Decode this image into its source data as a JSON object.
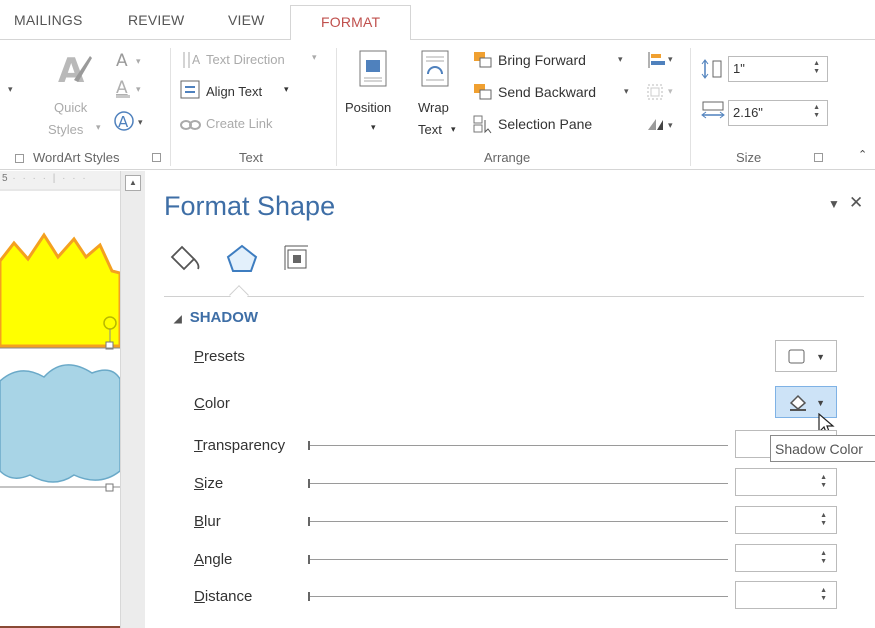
{
  "tabs": {
    "mailings": "MAILINGS",
    "review": "REVIEW",
    "view": "VIEW",
    "format": "FORMAT"
  },
  "ribbon": {
    "wordart": {
      "quick_styles_line1": "Quick",
      "quick_styles_line2": "Styles",
      "group_label": "WordArt Styles"
    },
    "text": {
      "text_direction": "Text Direction",
      "align_text": "Align Text",
      "create_link": "Create Link",
      "group_label": "Text"
    },
    "arrange": {
      "position": "Position",
      "wrap_line1": "Wrap",
      "wrap_line2": "Text",
      "bring_forward": "Bring Forward",
      "send_backward": "Send Backward",
      "selection_pane": "Selection Pane",
      "group_label": "Arrange"
    },
    "size": {
      "height_value": "1\"",
      "width_value": "2.16\"",
      "group_label": "Size"
    }
  },
  "ruler": {
    "mark": "5"
  },
  "pane": {
    "title": "Format Shape",
    "section": "SHADOW",
    "rows": {
      "presets": {
        "first": "P",
        "rest": "resets"
      },
      "color": {
        "first": "C",
        "rest": "olor"
      },
      "transparency": {
        "first": "T",
        "rest": "ransparency"
      },
      "size": {
        "first": "S",
        "rest": "ize"
      },
      "blur": {
        "first": "B",
        "rest": "lur"
      },
      "angle": {
        "first": "A",
        "rest": "ngle"
      },
      "distance": {
        "first": "D",
        "rest": "istance"
      }
    },
    "tooltip": "Shadow Color"
  },
  "icons": [
    "quick-styles-icon",
    "text-fill-icon",
    "text-outline-icon",
    "text-effects-icon",
    "text-direction-icon",
    "align-text-icon",
    "create-link-icon",
    "position-icon",
    "wrap-text-icon",
    "bring-forward-icon",
    "send-backward-icon",
    "selection-pane-icon",
    "align-icon",
    "group-icon",
    "rotate-icon",
    "height-icon",
    "width-icon",
    "fill-line-icon",
    "effects-icon",
    "layout-properties-icon",
    "preset-shadow-icon",
    "paint-bucket-icon",
    "mouse-cursor-icon"
  ],
  "colors": {
    "accent_format_tab": "#c0504d",
    "pane_title": "#3e6ea6",
    "hover_button": "#cde3f7",
    "burst_fill": "#ffff00",
    "burst_outline": "#f4a020",
    "cloud_fill": "#a8d4e6"
  }
}
